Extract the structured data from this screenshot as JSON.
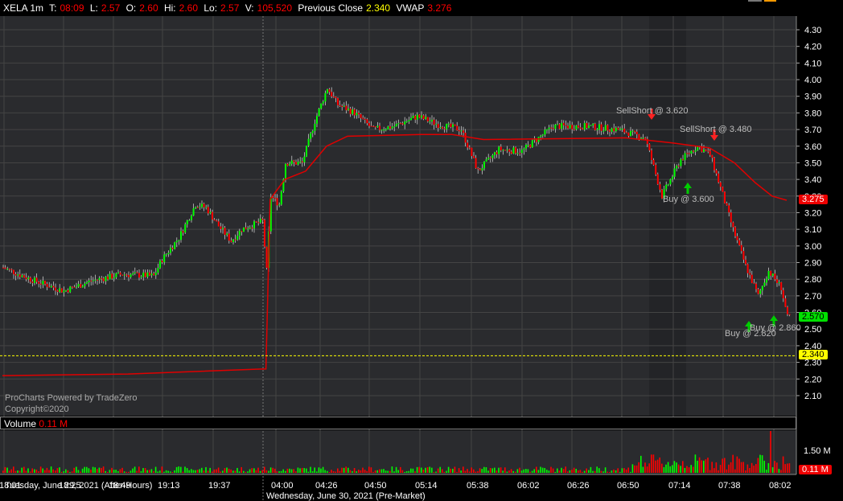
{
  "header": {
    "symbol": "XELA 1m",
    "t_label": "T:",
    "t": "08:09",
    "l_label": "L:",
    "l": "2.57",
    "o_label": "O:",
    "o": "2.60",
    "hi_label": "Hi:",
    "hi": "2.60",
    "lo_label": "Lo:",
    "lo": "2.57",
    "v_label": "V:",
    "v": "105,520",
    "prev_label": "Previous Close",
    "prev": "2.340",
    "vwap_label": "VWAP",
    "vwap": "3.276"
  },
  "watermark": {
    "line1": "ProCharts Powered by TradeZero",
    "line2": "Copyright©2020"
  },
  "volume": {
    "label": "Volume",
    "value": "0.11 M",
    "axis_label": "1.50 M",
    "last_badge": "0.11 M"
  },
  "badges": {
    "vwap": "3.275",
    "last": "2.570",
    "prev_close": "2.340"
  },
  "trades": [
    {
      "text": "SellShort @ 3.620",
      "side": "sell"
    },
    {
      "text": "SellShort @ 3.480",
      "side": "sell"
    },
    {
      "text": "Buy @ 3.600",
      "side": "buy"
    },
    {
      "text": "Buy @ 2.820",
      "side": "buy"
    },
    {
      "text": "Buy @ 2.860",
      "side": "buy"
    }
  ],
  "dates": {
    "left": "Tuesday, June 29, 2021 (After-Hours)",
    "right": "Wednesday, June 30, 2021 (Pre-Market)"
  },
  "colors": {
    "up": "#00ff00",
    "down": "#ff0000",
    "vwap": "#e00000",
    "prev_close": "#ffff00",
    "bg": "#2a2b2e"
  },
  "chart_data": {
    "type": "candlestick",
    "price_ticks": [
      "4.30",
      "4.20",
      "4.10",
      "4.00",
      "3.90",
      "3.80",
      "3.70",
      "3.60",
      "3.50",
      "3.40",
      "3.30",
      "3.20",
      "3.10",
      "3.00",
      "2.90",
      "2.80",
      "2.70",
      "2.60",
      "2.50",
      "2.40",
      "2.30",
      "2.20",
      "2.10"
    ],
    "ylim": [
      2.0,
      4.38
    ],
    "time_ticks": [
      "18:01",
      "18:25",
      "18:49",
      "19:13",
      "19:37",
      "04:00",
      "04:26",
      "04:50",
      "05:14",
      "05:38",
      "06:02",
      "06:26",
      "06:50",
      "07:14",
      "07:38",
      "08:02"
    ],
    "price_path": [
      [
        0,
        2.87
      ],
      [
        13,
        2.8
      ],
      [
        29,
        2.73
      ],
      [
        42,
        2.79
      ],
      [
        57,
        2.83
      ],
      [
        72,
        2.82
      ],
      [
        76,
        2.92
      ],
      [
        84,
        3.05
      ],
      [
        92,
        3.25
      ],
      [
        97,
        3.23
      ],
      [
        103,
        3.12
      ],
      [
        109,
        3.03
      ],
      [
        114,
        3.1
      ],
      [
        124,
        3.15
      ],
      [
        126,
        2.85
      ],
      [
        128,
        3.3
      ],
      [
        132,
        3.25
      ],
      [
        135,
        3.5
      ],
      [
        143,
        3.5
      ],
      [
        149,
        3.75
      ],
      [
        155,
        3.95
      ],
      [
        160,
        3.85
      ],
      [
        168,
        3.8
      ],
      [
        177,
        3.7
      ],
      [
        187,
        3.72
      ],
      [
        198,
        3.78
      ],
      [
        208,
        3.73
      ],
      [
        219,
        3.7
      ],
      [
        227,
        3.45
      ],
      [
        237,
        3.58
      ],
      [
        248,
        3.57
      ],
      [
        256,
        3.65
      ],
      [
        263,
        3.72
      ],
      [
        279,
        3.72
      ],
      [
        294,
        3.7
      ],
      [
        307,
        3.65
      ],
      [
        315,
        3.3
      ],
      [
        324,
        3.52
      ],
      [
        332,
        3.6
      ],
      [
        338,
        3.55
      ],
      [
        343,
        3.35
      ],
      [
        349,
        3.1
      ],
      [
        355,
        2.88
      ],
      [
        361,
        2.7
      ],
      [
        366,
        2.85
      ],
      [
        372,
        2.75
      ],
      [
        375,
        2.57
      ]
    ],
    "vwap_path": [
      [
        0,
        2.22
      ],
      [
        60,
        2.23
      ],
      [
        124,
        2.26
      ],
      [
        126,
        2.26
      ],
      [
        128,
        3.28
      ],
      [
        135,
        3.4
      ],
      [
        145,
        3.45
      ],
      [
        155,
        3.6
      ],
      [
        165,
        3.66
      ],
      [
        200,
        3.67
      ],
      [
        215,
        3.67
      ],
      [
        230,
        3.64
      ],
      [
        298,
        3.65
      ],
      [
        320,
        3.62
      ],
      [
        338,
        3.59
      ],
      [
        350,
        3.5
      ],
      [
        360,
        3.38
      ],
      [
        368,
        3.3
      ],
      [
        375,
        3.275
      ]
    ],
    "prev_close": 2.34,
    "last": 2.57,
    "vwap_last": 3.275,
    "bars": 376
  }
}
